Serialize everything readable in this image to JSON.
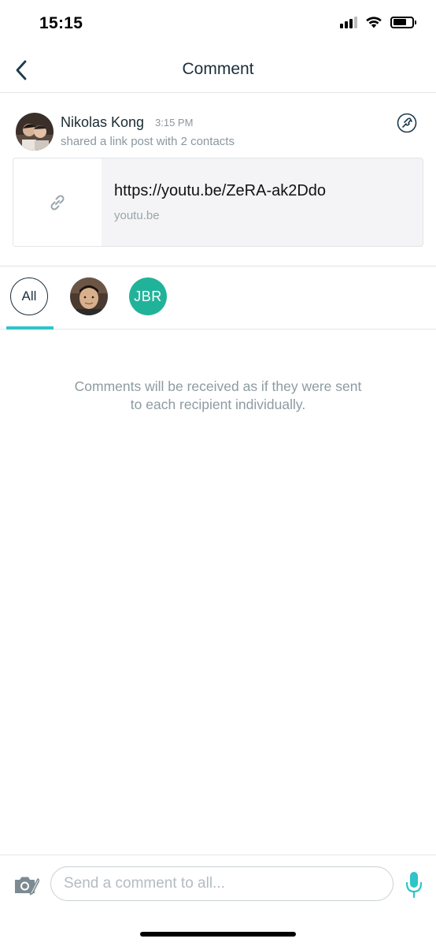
{
  "status_bar": {
    "time": "15:15"
  },
  "nav": {
    "title": "Comment"
  },
  "post": {
    "author_name": "Nikolas Kong",
    "time": "3:15 PM",
    "description": "shared a link post with 2 contacts",
    "link": {
      "url": "https://youtu.be/ZeRA-ak2Ddo",
      "domain": "youtu.be"
    }
  },
  "recipients": {
    "tabs": [
      {
        "label": "All",
        "selected": true
      },
      {
        "label": "",
        "type": "photo"
      },
      {
        "label": "JBR",
        "type": "initials",
        "color": "#21b39a"
      }
    ]
  },
  "empty_message": {
    "line1": "Comments will be received as if they were sent",
    "line2": "to each recipient individually."
  },
  "composer": {
    "placeholder": "Send a comment to all..."
  },
  "colors": {
    "accent": "#2ec4c9",
    "jbr_avatar": "#21b39a",
    "title": "#1c2f3c",
    "muted": "#8a979e"
  },
  "icons": [
    "back-chevron-icon",
    "reaction-icon",
    "link-icon",
    "camera-icon",
    "microphone-icon"
  ]
}
